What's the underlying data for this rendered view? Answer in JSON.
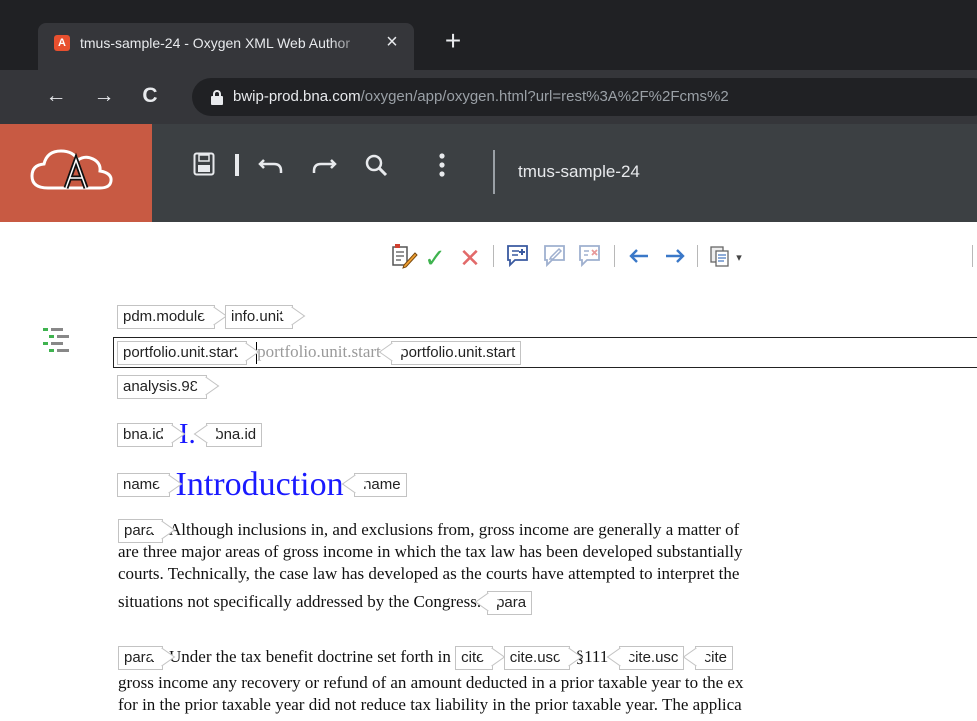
{
  "browser": {
    "tab_title": "tmus-sample-24 - Oxygen XML Web Author",
    "tab_close": "×",
    "new_tab": "+",
    "favicon_letter": "A",
    "nav": {
      "back": "←",
      "forward": "→",
      "reload": "C"
    },
    "url_host": "bwip-prod.bna.com",
    "url_path": "/oxygen/app/oxygen.html?url=rest%3A%2F%2Fcms%2"
  },
  "oxygen_header": {
    "logo_letter": "A",
    "logo_bg": "#c85a43",
    "document_title": "tmus-sample-24",
    "tools": [
      "save-icon",
      "undo-icon",
      "redo-icon",
      "search-icon",
      "more-icon"
    ]
  },
  "edit_toolbar": {
    "tools": [
      "track-changes-icon",
      "accept-change-icon",
      "reject-change-icon",
      "add-comment-icon",
      "edit-comment-icon",
      "remove-comment-icon",
      "previous-change-icon",
      "next-change-icon",
      "paste-special-icon"
    ],
    "dropdown_arrow": "▾"
  },
  "editor": {
    "breadcrumb": [
      "pdm.module",
      "info.unit"
    ],
    "selected_row": {
      "open_tag": "portfolio.unit.start",
      "placeholder": "portfolio.unit.start",
      "close_tag": "portfolio.unit.start"
    },
    "analysis_tag": "analysis.98",
    "bna_id": {
      "tag": "bna.id",
      "value": "I."
    },
    "name": {
      "tag": "name",
      "value": "Introduction"
    },
    "para1": {
      "tag": "para",
      "line1": "Although inclusions in, and exclusions from, gross income are generally a matter of",
      "line2": "are three major areas of gross income in which the tax law has been developed substantially",
      "line3": "courts. Technically, the case law has developed as the courts have attempted to interpret the",
      "line4": "situations not specifically addressed by the Congress."
    },
    "para2": {
      "tag": "para",
      "lead": "Under the tax benefit doctrine set forth in",
      "cite_tag": "cite",
      "cite_usc_tag": "cite.usc",
      "section": "§111",
      "line2": "gross income any recovery or refund of an amount deducted in a prior taxable year to the ex",
      "line3": "for in the prior taxable year did not reduce tax liability in the prior taxable year. The applica"
    }
  }
}
